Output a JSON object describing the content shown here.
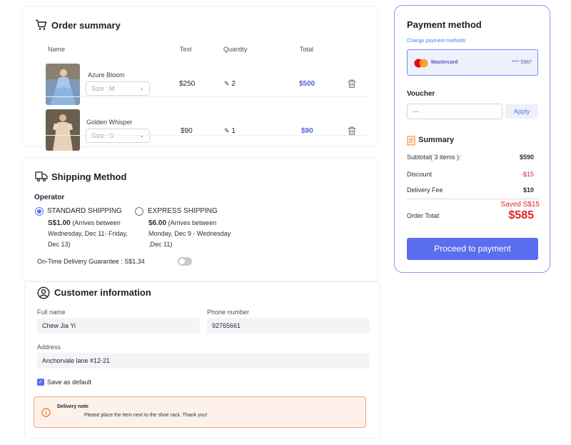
{
  "order_summary": {
    "title": "Order summary",
    "columns": {
      "name": "Name",
      "text": "Text",
      "quantity": "Quantity",
      "total": "Total"
    },
    "items": [
      {
        "name": "Azure Bloom",
        "size": "Size : M",
        "price": "$250",
        "quantity": "2",
        "total": "$500"
      },
      {
        "name": "Golden Whisper",
        "size": "Size : S",
        "price": "$90",
        "quantity": "1",
        "total": "$90"
      }
    ]
  },
  "shipping": {
    "title": "Shipping Method",
    "operator_label": "Operator",
    "options": [
      {
        "label": "STANDARD SHIPPING",
        "price": "S$1.00",
        "detail_1": "(Arrives between",
        "detail_2": "Wednesday, Dec 11- Friday,",
        "detail_3": "Dec 13)",
        "selected": true
      },
      {
        "label": "EXPRESS SHIPPING",
        "price": "$6.00",
        "detail_1": "(Arrives between",
        "detail_2": "Monday, Dec 9 - Wednesday",
        "detail_3": ",Dec 11)",
        "selected": false
      }
    ],
    "guarantee": "On-Time Delivery Guarantee : S$1.34"
  },
  "customer": {
    "title": "Customer information",
    "full_name_label": "Full name",
    "full_name": "Chew Jia Yi",
    "phone_label": "Phone number",
    "phone": "92765661",
    "address_label": "Address",
    "address": "Anchorvale lane #12-21",
    "save_default": "Save as default",
    "note_title": "Delivery note",
    "note_text": "Please place the item next to the shoe rack. Thank you!"
  },
  "payment": {
    "title": "Payment method",
    "change_link": "Change payment methods",
    "card_brand": "Mastercard",
    "card_number": "**** 5987",
    "voucher_label": "Voucher",
    "voucher_placeholder": "---",
    "apply": "Apply",
    "summary_title": "Summary",
    "subtotal_label": "Subtotal( 3 items ):",
    "subtotal": "$590",
    "discount_label": "Discount",
    "discount": "-$15",
    "delivery_label": "Delivery Fee",
    "delivery": "$10",
    "saved": "Saved S$15",
    "order_total_label": "Order Total:",
    "order_total": "$585",
    "proceed": "Proceed to payment"
  },
  "colors": {
    "accent": "#5b6ef0",
    "price_blue": "#4f63d8",
    "danger": "#e02424",
    "note_bg": "#fdf1ea",
    "note_border": "#f3a77f"
  }
}
